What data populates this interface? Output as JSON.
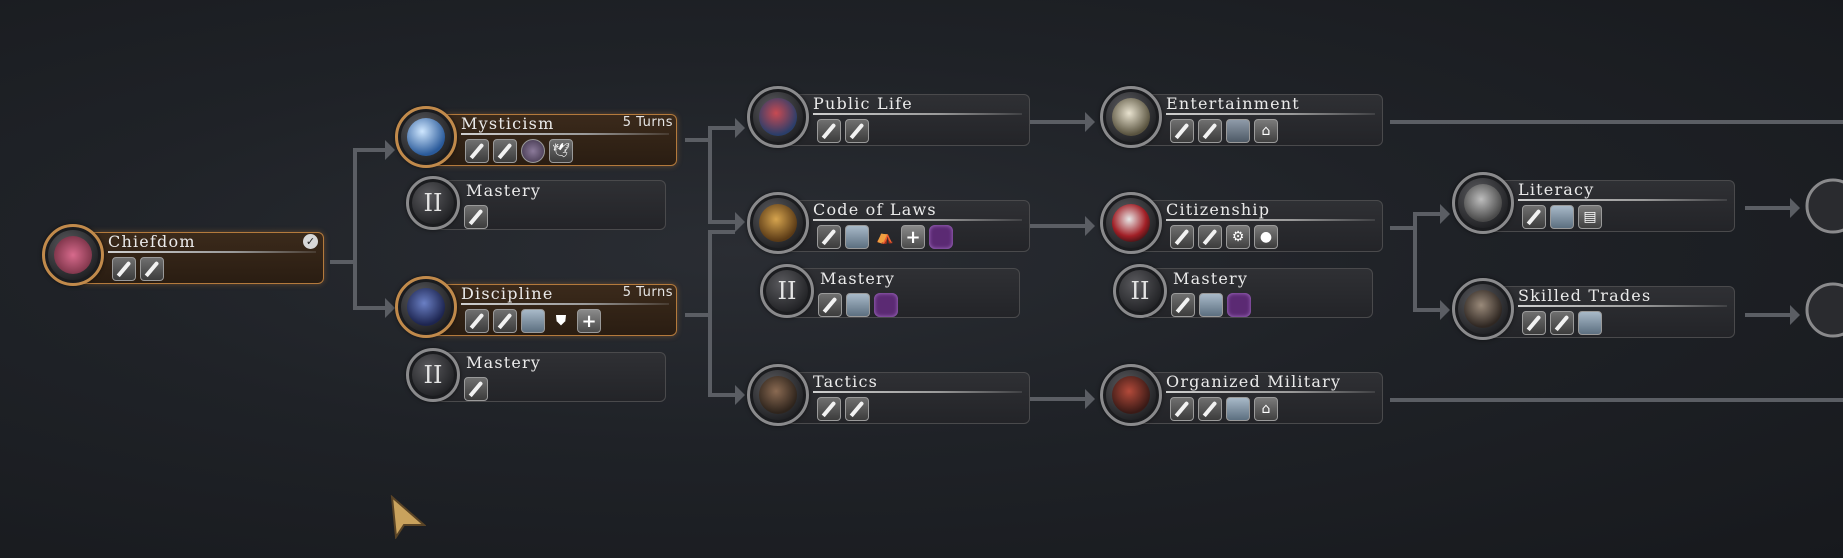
{
  "screen": "civic_tree",
  "colors": {
    "background": "#1f2227",
    "active_border": "#b47a3c",
    "connector": "#5b5e64",
    "node_bar": "#2f3034"
  },
  "nodes": {
    "chiefdom": {
      "title": "Chiefdom",
      "completed_icon": "check-icon",
      "emblem_icon": "portrait-icon",
      "unlocks": [
        "quill-icon",
        "quill-icon"
      ]
    },
    "mysticism": {
      "title": "Mysticism",
      "turns": "5 Turns",
      "emblem_icon": "crystal-orb-icon",
      "unlocks": [
        "quill-icon",
        "quill-icon",
        "temple-icon",
        "dove-icon"
      ]
    },
    "mysticism_mastery": {
      "title": "Mastery",
      "numeral": "II",
      "unlocks": [
        "quill-icon"
      ]
    },
    "discipline": {
      "title": "Discipline",
      "turns": "5 Turns",
      "emblem_icon": "warrior-icon",
      "unlocks": [
        "quill-icon",
        "quill-icon",
        "barracks-icon",
        "shield-icon",
        "plus-icon"
      ]
    },
    "discipline_mastery": {
      "title": "Mastery",
      "numeral": "II",
      "unlocks": [
        "quill-icon"
      ]
    },
    "public_life": {
      "title": "Public Life",
      "emblem_icon": "statue-icon",
      "unlocks": [
        "quill-icon",
        "quill-icon"
      ]
    },
    "code_of_laws": {
      "title": "Code of Laws",
      "emblem_icon": "scales-icon",
      "unlocks": [
        "quill-icon",
        "courthouse-icon",
        "tent-icon",
        "plus-icon",
        "hex-tile-icon"
      ]
    },
    "code_mastery": {
      "title": "Mastery",
      "numeral": "II",
      "unlocks": [
        "quill-icon",
        "courthouse-icon",
        "hex-tile-icon"
      ]
    },
    "tactics": {
      "title": "Tactics",
      "emblem_icon": "helmet-icon",
      "unlocks": [
        "quill-icon",
        "quill-icon"
      ]
    },
    "entertainment": {
      "title": "Entertainment",
      "emblem_icon": "mask-icon",
      "unlocks": [
        "quill-icon",
        "quill-icon",
        "arena-icon",
        "house-icon"
      ]
    },
    "citizenship": {
      "title": "Citizenship",
      "emblem_icon": "banner-icon",
      "unlocks": [
        "quill-icon",
        "quill-icon",
        "gear-icon",
        "bulb-icon"
      ]
    },
    "citizenship_mastery": {
      "title": "Mastery",
      "numeral": "II",
      "unlocks": [
        "quill-icon",
        "courthouse-icon",
        "hex-tile-icon"
      ]
    },
    "organized_military": {
      "title": "Organized Military",
      "emblem_icon": "soldier-icon",
      "unlocks": [
        "quill-icon",
        "quill-icon",
        "fort-icon",
        "house-icon"
      ]
    },
    "literacy": {
      "title": "Literacy",
      "emblem_icon": "tablet-icon",
      "unlocks": [
        "quill-icon",
        "library-icon",
        "scroll-icon"
      ]
    },
    "skilled_trades": {
      "title": "Skilled Trades",
      "emblem_icon": "craftsman-icon",
      "unlocks": [
        "quill-icon",
        "quill-icon",
        "workshop-icon"
      ]
    }
  },
  "cursor_icon": "pointer-icon"
}
